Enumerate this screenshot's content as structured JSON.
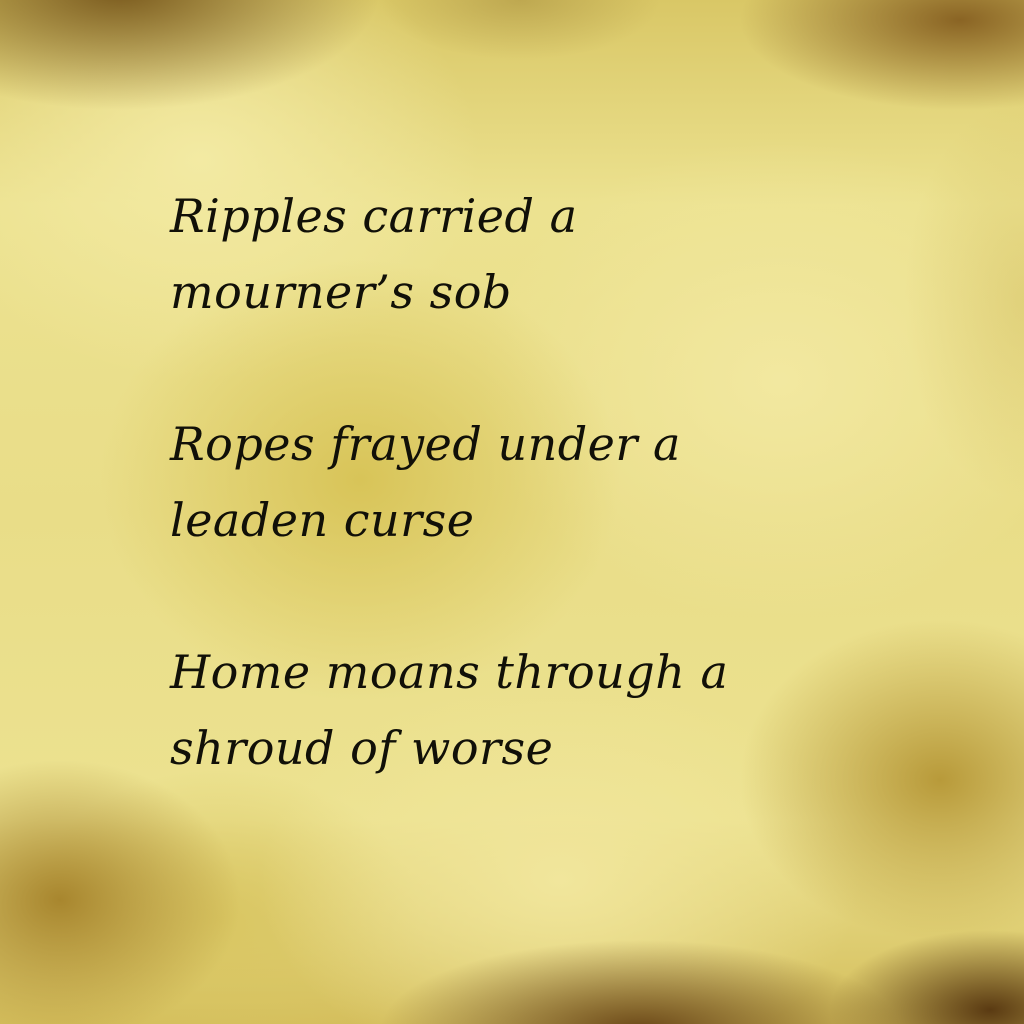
{
  "poem": {
    "stanzas": [
      {
        "lines": [
          "Ripples carried a",
          "mourner’s sob"
        ]
      },
      {
        "lines": [
          "Ropes frayed under a",
          "leaden curse"
        ]
      },
      {
        "lines": [
          "Home moans through a",
          "shroud of worse"
        ]
      }
    ]
  },
  "colors": {
    "text": "#111008",
    "background": "#ece08e",
    "shadow_brown": "#6b4818"
  }
}
